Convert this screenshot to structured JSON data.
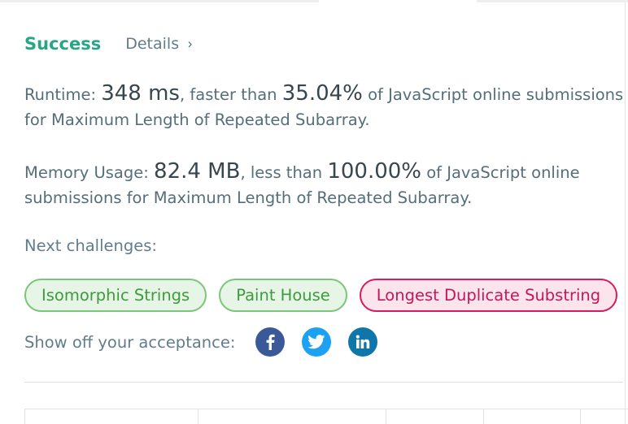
{
  "status": {
    "result": "Success",
    "details_label": "Details",
    "chevron": "›"
  },
  "runtime": {
    "label": "Runtime: ",
    "value": "348 ms",
    "mid": ", faster than ",
    "percent": "35.04%",
    "suffix": " of JavaScript online submissions for Maximum Length of Repeated Subarray."
  },
  "memory": {
    "label": "Memory Usage: ",
    "value": "82.4 MB",
    "mid": ", less than ",
    "percent": "100.00%",
    "suffix": " of JavaScript online submissions for Maximum Length of Repeated Subarray."
  },
  "next": {
    "label": "Next challenges:",
    "challenges": [
      {
        "title": "Isomorphic Strings",
        "difficulty": "easy"
      },
      {
        "title": "Paint House",
        "difficulty": "easy"
      },
      {
        "title": "Longest Duplicate Substring",
        "difficulty": "hard"
      }
    ]
  },
  "share": {
    "label": "Show off your acceptance:",
    "icons": [
      "facebook-icon",
      "twitter-icon",
      "linkedin-icon"
    ]
  },
  "colors": {
    "success": "#26a587",
    "easy_chip": "#7bc67a",
    "hard_chip": "#d81b60",
    "facebook": "#3b5998",
    "twitter": "#1da1f2",
    "linkedin": "#0e76a8"
  }
}
